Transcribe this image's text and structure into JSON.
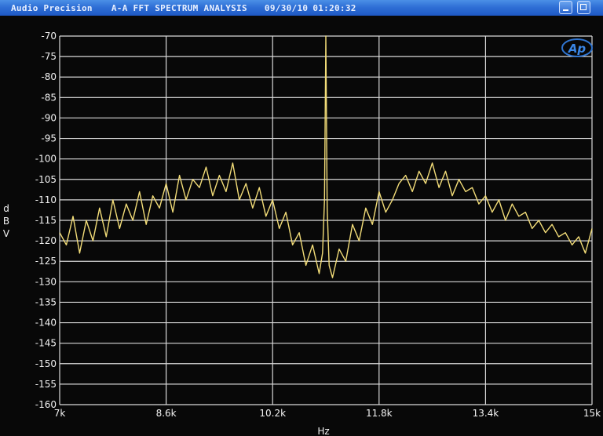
{
  "window": {
    "app": "Audio Precision",
    "title": "A-A FFT SPECTRUM ANALYSIS",
    "date": "09/30/10",
    "time": "01:20:32",
    "logo_text": "Ap",
    "icons": [
      "minimize-icon",
      "maximize-icon"
    ]
  },
  "colors": {
    "trace": "#f2dc78",
    "grid": "#d9d9d9",
    "background": "#080808",
    "text": "#f2f2f2"
  },
  "chart_data": {
    "type": "line",
    "title": "",
    "xlabel": "Hz",
    "ylabel": "dBV",
    "ylabel_chars": [
      "d",
      "B",
      "V"
    ],
    "xlim": [
      7000,
      15000
    ],
    "ylim": [
      -160,
      -70
    ],
    "x_ticks": [
      7000,
      8600,
      10200,
      11800,
      13400,
      15000
    ],
    "x_tick_labels": [
      "7k",
      "8.6k",
      "10.2k",
      "11.8k",
      "13.4k",
      "15k"
    ],
    "y_ticks": [
      -70,
      -75,
      -80,
      -85,
      -90,
      -95,
      -100,
      -105,
      -110,
      -115,
      -120,
      -125,
      -130,
      -135,
      -140,
      -145,
      -150,
      -155,
      -160
    ],
    "y_tick_labels": [
      "-70",
      "-75",
      "-80",
      "-85",
      "-90",
      "-95",
      "-100",
      "-105",
      "-110",
      "-115",
      "-120",
      "-125",
      "-130",
      "-135",
      "-140",
      "-145",
      "-150",
      "-155",
      "-160"
    ],
    "grid": true,
    "series": [
      {
        "x": [
          7000,
          7100,
          7200,
          7300,
          7400,
          7500,
          7600,
          7700,
          7800,
          7900,
          8000,
          8100,
          8200,
          8300,
          8400,
          8500,
          8600,
          8700,
          8800,
          8900,
          9000,
          9100,
          9200,
          9300,
          9400,
          9500,
          9600,
          9700,
          9800,
          9900,
          10000,
          10100,
          10200,
          10300,
          10400,
          10500,
          10600,
          10700,
          10800,
          10900,
          10950,
          10980,
          11000,
          11020,
          11050,
          11100,
          11200,
          11300,
          11400,
          11500,
          11600,
          11700,
          11800,
          11900,
          12000,
          12100,
          12200,
          12300,
          12400,
          12500,
          12600,
          12700,
          12800,
          12900,
          13000,
          13100,
          13200,
          13300,
          13400,
          13500,
          13600,
          13700,
          13800,
          13900,
          14000,
          14100,
          14200,
          14300,
          14400,
          14500,
          14600,
          14700,
          14800,
          14900,
          15000
        ],
        "y": [
          -118,
          -121,
          -114,
          -123,
          -115,
          -120,
          -112,
          -119,
          -110,
          -117,
          -111,
          -115,
          -108,
          -116,
          -109,
          -112,
          -106,
          -113,
          -104,
          -110,
          -105,
          -107,
          -102,
          -109,
          -104,
          -108,
          -101,
          -110,
          -106,
          -112,
          -107,
          -114,
          -110,
          -117,
          -113,
          -121,
          -118,
          -126,
          -121,
          -128,
          -123,
          -110,
          -70,
          -112,
          -126,
          -129,
          -122,
          -125,
          -116,
          -120,
          -112,
          -116,
          -108,
          -113,
          -110,
          -106,
          -104,
          -108,
          -103,
          -106,
          -101,
          -107,
          -103,
          -109,
          -105,
          -108,
          -107,
          -111,
          -109,
          -113,
          -110,
          -115,
          -111,
          -114,
          -113,
          -117,
          -115,
          -118,
          -116,
          -119,
          -118,
          -121,
          -119,
          -123,
          -117
        ]
      }
    ],
    "annotations": []
  }
}
